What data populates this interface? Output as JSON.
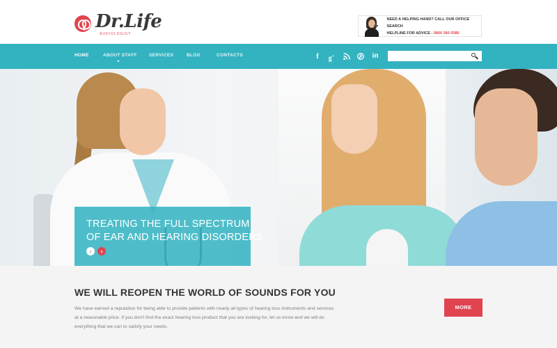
{
  "header": {
    "logo_title": "Dr.Life",
    "logo_subtitle": "AUDIOLOGIST",
    "helpline_line1": "NEED A HELPING HAND? CALL OUR OFFICE SEARCH",
    "helpline_line2_label": "HELPLINE FOR ADVICE - ",
    "helpline_phone": "0800 360 0380"
  },
  "nav": {
    "items": [
      {
        "label": "HOME",
        "active": true
      },
      {
        "label": "ABOUT STAFF",
        "active": false
      },
      {
        "label": "SERVICES",
        "active": false
      },
      {
        "label": "BLOG",
        "active": false
      },
      {
        "label": "CONTACTS",
        "active": false
      }
    ],
    "social": [
      {
        "icon": "facebook-icon",
        "glyph": "f"
      },
      {
        "icon": "google-plus-icon",
        "glyph": "g+"
      },
      {
        "icon": "rss-icon",
        "glyph": "rss"
      },
      {
        "icon": "pinterest-icon",
        "glyph": "p"
      },
      {
        "icon": "linkedin-icon",
        "glyph": "in"
      }
    ],
    "search_placeholder": ""
  },
  "hero": {
    "caption_line1": "TREATING THE FULL SPECTRUM",
    "caption_line2": "OF EAR AND HEARING DISORDERS",
    "prev_glyph": "‹",
    "next_glyph": "›"
  },
  "intro": {
    "title": "WE WILL REOPEN THE WORLD OF SOUNDS FOR YOU",
    "text_line1": "We have earned a reputation for being able to provide patients with nearly all types of hearing loss instruments and services",
    "text_line2": "at a reasonable price. If you don't find the exact hearing loss product that you are looking for, let us know and we will do",
    "text_line3": "everything that we can to satisfy your needs.",
    "more_label": "MORE"
  },
  "colors": {
    "accent_teal": "#33b2c0",
    "accent_red": "#e0444e"
  }
}
